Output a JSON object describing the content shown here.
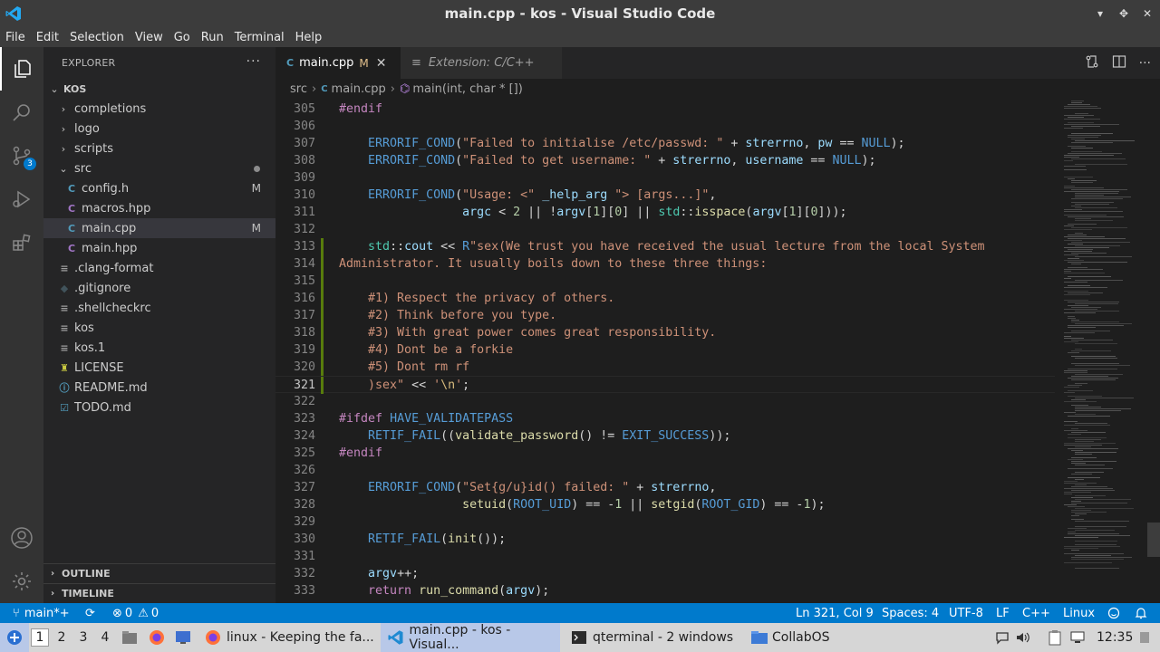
{
  "window": {
    "title": "main.cpp - kos - Visual Studio Code"
  },
  "menu": [
    "File",
    "Edit",
    "Selection",
    "View",
    "Go",
    "Run",
    "Terminal",
    "Help"
  ],
  "activity": {
    "scm_badge": "3"
  },
  "sidebar": {
    "title": "EXPLORER",
    "more": "···",
    "root": "KOS",
    "items": [
      {
        "label": "completions",
        "icon": "folder-closed"
      },
      {
        "label": "logo",
        "icon": "folder-closed"
      },
      {
        "label": "scripts",
        "icon": "folder-closed"
      },
      {
        "label": "src",
        "icon": "folder-open"
      },
      {
        "label": "config.h",
        "icon": "c-icon",
        "status": "M"
      },
      {
        "label": "macros.hpp",
        "icon": "cpp-icon"
      },
      {
        "label": "main.cpp",
        "icon": "cpp-icon",
        "status": "M"
      },
      {
        "label": "main.hpp",
        "icon": "cpp-icon"
      },
      {
        "label": ".clang-format",
        "icon": "lines-icon"
      },
      {
        "label": ".gitignore",
        "icon": "git-icon"
      },
      {
        "label": ".shellcheckrc",
        "icon": "lines-icon"
      },
      {
        "label": "kos",
        "icon": "lines-icon"
      },
      {
        "label": "kos.1",
        "icon": "lines-icon"
      },
      {
        "label": "LICENSE",
        "icon": "license-icon"
      },
      {
        "label": "README.md",
        "icon": "info-icon"
      },
      {
        "label": "TODO.md",
        "icon": "todo-icon"
      }
    ],
    "outline": "OUTLINE",
    "timeline": "TIMELINE"
  },
  "tabs": [
    {
      "label": "main.cpp",
      "modified": "M"
    },
    {
      "label": "Extension: C/C++"
    }
  ],
  "breadcrumb": [
    "src",
    "main.cpp",
    "main(int, char * [])"
  ],
  "code": {
    "line_numbers": [
      "305",
      "306",
      "307",
      "308",
      "309",
      "310",
      "311",
      "312",
      "313",
      "314",
      "315",
      "316",
      "317",
      "318",
      "319",
      "320",
      "321",
      "322",
      "323",
      "324",
      "325",
      "326",
      "327",
      "328",
      "329",
      "330",
      "331",
      "332",
      "333"
    ]
  },
  "status": {
    "branch": "main*+",
    "errors": "0",
    "warnings": "0",
    "position": "Ln 321, Col 9",
    "spaces": "Spaces: 4",
    "encoding": "UTF-8",
    "eol": "LF",
    "language": "C++",
    "platform": "Linux"
  },
  "taskbar": {
    "workspaces": [
      "1",
      "2",
      "3",
      "4"
    ],
    "windows": [
      {
        "label": "linux - Keeping the fa..."
      },
      {
        "label": "main.cpp - kos - Visual..."
      },
      {
        "label": "qterminal - 2 windows"
      },
      {
        "label": "CollabOS"
      }
    ],
    "clock": "12:35"
  },
  "colors": {
    "accent": "#007acc",
    "titlebar": "#3c3c3c",
    "editor_bg": "#1e1e1e",
    "sidebar_bg": "#252526"
  }
}
